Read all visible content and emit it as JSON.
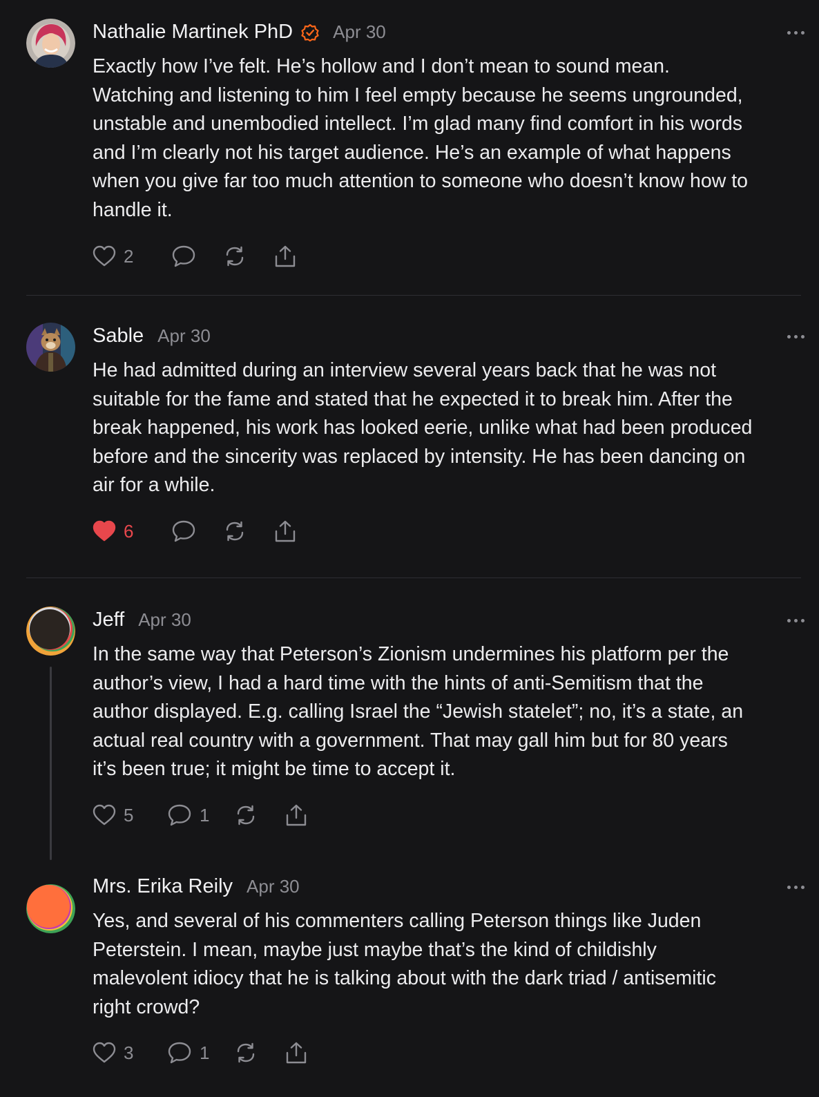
{
  "comments": [
    {
      "author": "Nathalie Martinek PhD",
      "verified": true,
      "date": "Apr 30",
      "text": "Exactly how I’ve felt. He’s hollow and I don’t mean to sound mean.\nWatching and listening to him I feel empty because he seems ungrounded,\nunstable and unembodied intellect. I’m glad many find comfort in his words\nand I’m clearly not his target audience. He’s an example of what happens\nwhen you give far too much attention to someone who doesn’t know how to\nhandle it.",
      "likes": "2",
      "liked": false,
      "replies": ""
    },
    {
      "author": "Sable",
      "verified": false,
      "date": "Apr 30",
      "text": "He had admitted during an interview several years back that he was not\nsuitable for the fame and stated that he expected it to break him. After the\nbreak happened, his work has looked eerie, unlike what had been produced\nbefore and the sincerity was replaced by intensity. He has been dancing on\nair for a while.",
      "likes": "6",
      "liked": true,
      "replies": ""
    },
    {
      "author": "Jeff",
      "verified": false,
      "date": "Apr 30",
      "text": "In the same way that Peterson’s Zionism undermines his platform per the\nauthor’s view, I had a hard time with the hints of anti-Semitism that the\nauthor displayed. E.g. calling Israel the “Jewish statelet”; no, it’s a state, an\nactual real country with a government. That may gall him but for 80 years\nit’s been true; it might be time to accept it.",
      "likes": "5",
      "liked": false,
      "replies": "1"
    },
    {
      "author": "Mrs. Erika Reily",
      "verified": false,
      "date": "Apr 30",
      "text": "Yes, and several of his commenters calling Peterson things like Juden\nPeterstein. I mean, maybe just maybe that’s the kind of childishly\nmalevolent idiocy that he is talking about with the dark triad / antisemitic\nright crowd?",
      "likes": "3",
      "liked": false,
      "replies": "1"
    }
  ],
  "icons": {
    "heart": "heart-icon",
    "comment": "comment-bubble-icon",
    "restack": "restack-icon",
    "share": "share-icon",
    "more": "more-options-icon",
    "verified": "verified-badge-icon"
  },
  "colors": {
    "background": "#151517",
    "text": "#ececee",
    "muted": "#8d8d93",
    "like_active": "#e8474c",
    "verified": "#ff6719",
    "divider": "#2e2e33"
  }
}
